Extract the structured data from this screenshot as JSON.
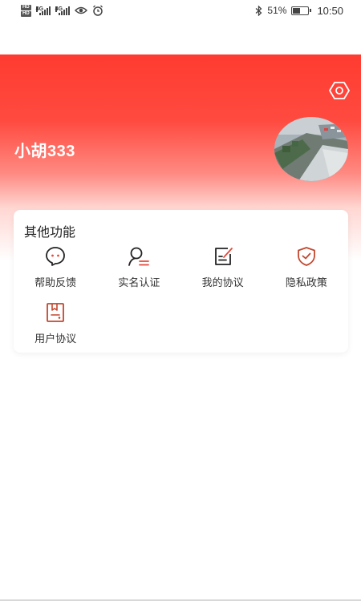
{
  "status_bar": {
    "sim1": "HD",
    "sim2": "HD",
    "net1": "4G",
    "net2": "4G",
    "battery_percent": "51%",
    "battery_level": 0.51,
    "time": "10:50",
    "icons": [
      "eye-icon",
      "alarm-icon",
      "bluetooth-icon",
      "battery-icon"
    ]
  },
  "profile": {
    "username": "小胡333"
  },
  "functions": {
    "title": "其他功能",
    "items": [
      {
        "label": "帮助反馈",
        "icon": "chat-bubble-icon"
      },
      {
        "label": "实名认证",
        "icon": "user-verify-icon"
      },
      {
        "label": "我的协议",
        "icon": "edit-document-icon"
      },
      {
        "label": "隐私政策",
        "icon": "shield-check-icon"
      },
      {
        "label": "用户协议",
        "icon": "document-bookmark-icon"
      }
    ]
  },
  "colors": {
    "brand_red": "#ff3b30",
    "icon_accent": "#e4493b"
  }
}
